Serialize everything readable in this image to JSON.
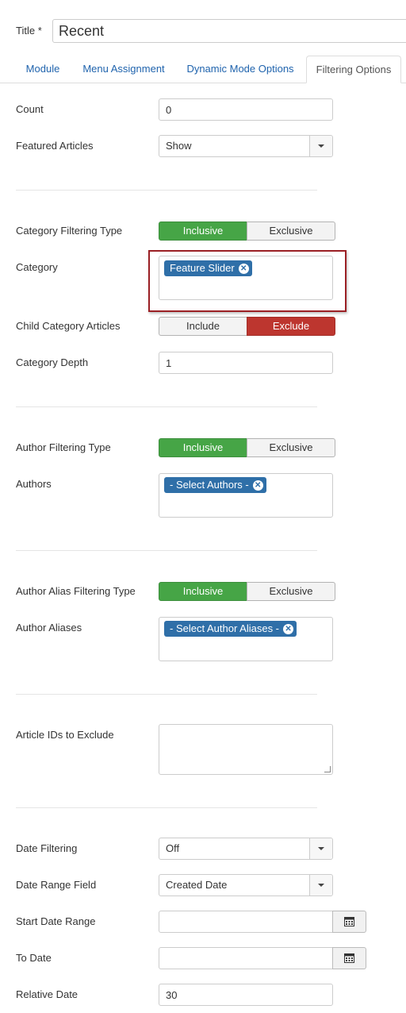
{
  "title": {
    "label": "Title *",
    "value": "Recent"
  },
  "tabs": [
    {
      "label": "Module"
    },
    {
      "label": "Menu Assignment"
    },
    {
      "label": "Dynamic Mode Options"
    },
    {
      "label": "Filtering Options"
    }
  ],
  "fields": {
    "count": {
      "label": "Count",
      "value": "0"
    },
    "featured": {
      "label": "Featured Articles",
      "value": "Show"
    },
    "category_filtering_type": {
      "label": "Category Filtering Type",
      "on": "Inclusive",
      "off": "Exclusive"
    },
    "category": {
      "label": "Category",
      "tag": "Feature Slider"
    },
    "child_category": {
      "label": "Child Category Articles",
      "on": "Include",
      "off": "Exclude"
    },
    "category_depth": {
      "label": "Category Depth",
      "value": "1"
    },
    "author_filtering_type": {
      "label": "Author Filtering Type",
      "on": "Inclusive",
      "off": "Exclusive"
    },
    "authors": {
      "label": "Authors",
      "tag": "- Select Authors -"
    },
    "author_alias_filtering_type": {
      "label": "Author Alias Filtering Type",
      "on": "Inclusive",
      "off": "Exclusive"
    },
    "author_aliases": {
      "label": "Author Aliases",
      "tag": "- Select Author Aliases -"
    },
    "article_ids": {
      "label": "Article IDs to Exclude",
      "value": ""
    },
    "date_filtering": {
      "label": "Date Filtering",
      "value": "Off"
    },
    "date_range_field": {
      "label": "Date Range Field",
      "value": "Created Date"
    },
    "start_date": {
      "label": "Start Date Range",
      "value": ""
    },
    "to_date": {
      "label": "To Date",
      "value": ""
    },
    "relative_date": {
      "label": "Relative Date",
      "value": "30"
    }
  },
  "colors": {
    "green": "#46a546",
    "red": "#bd362f",
    "chip": "#2f6fa8",
    "highlight": "#9b2025"
  }
}
